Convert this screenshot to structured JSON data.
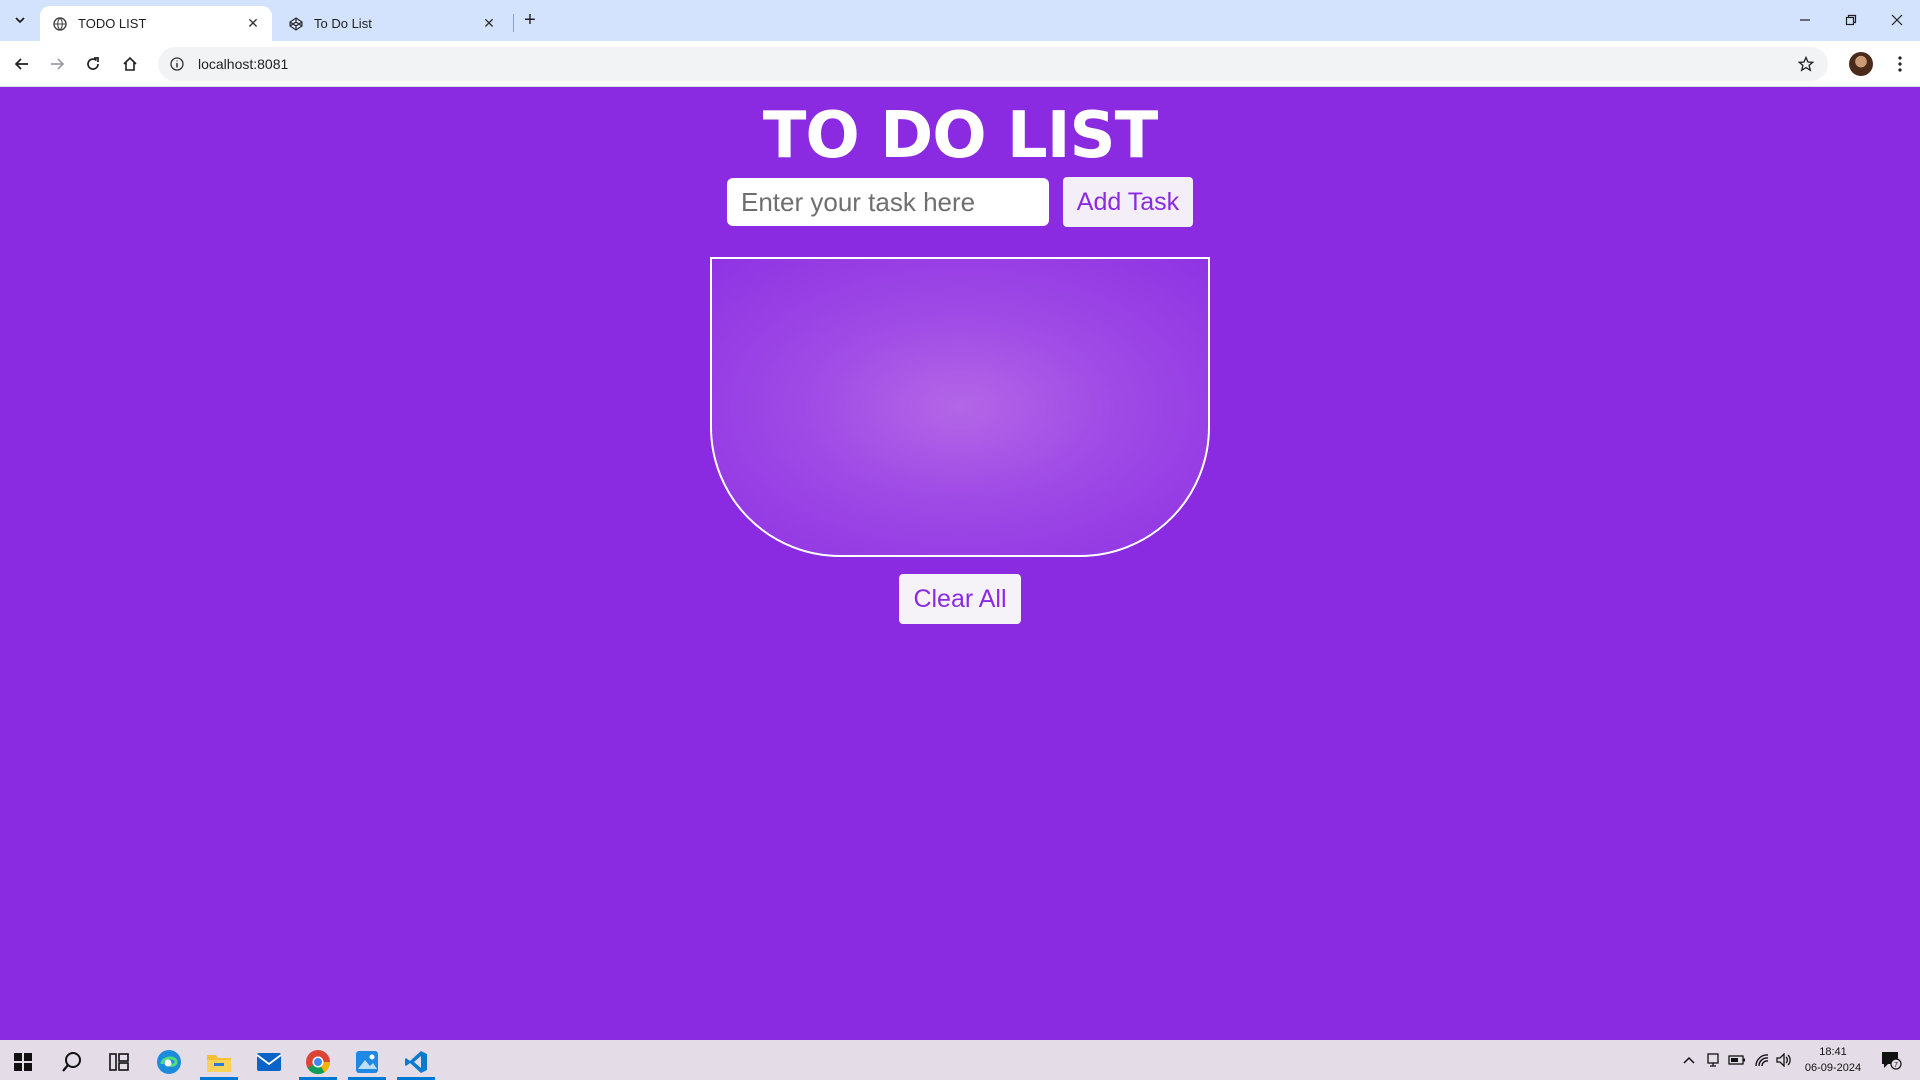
{
  "browser": {
    "tabs": [
      {
        "title": "TODO LIST",
        "icon": "globe-icon"
      },
      {
        "title": "To Do List",
        "icon": "codepen-icon"
      }
    ],
    "url": "localhost:8081"
  },
  "app": {
    "heading": "TO DO LIST",
    "input_placeholder": "Enter your task here",
    "add_button": "Add Task",
    "clear_button": "Clear All",
    "tasks": [],
    "colors": {
      "background": "#8a2be2",
      "button_text": "#8a2be2"
    }
  },
  "taskbar": {
    "time": "18:41",
    "date": "06-09-2024",
    "notification_count": "7",
    "apps": [
      "start-icon",
      "search-icon",
      "task-view-icon",
      "edge-icon",
      "file-explorer-icon",
      "mail-icon",
      "chrome-icon",
      "photos-icon",
      "vscode-icon"
    ]
  }
}
